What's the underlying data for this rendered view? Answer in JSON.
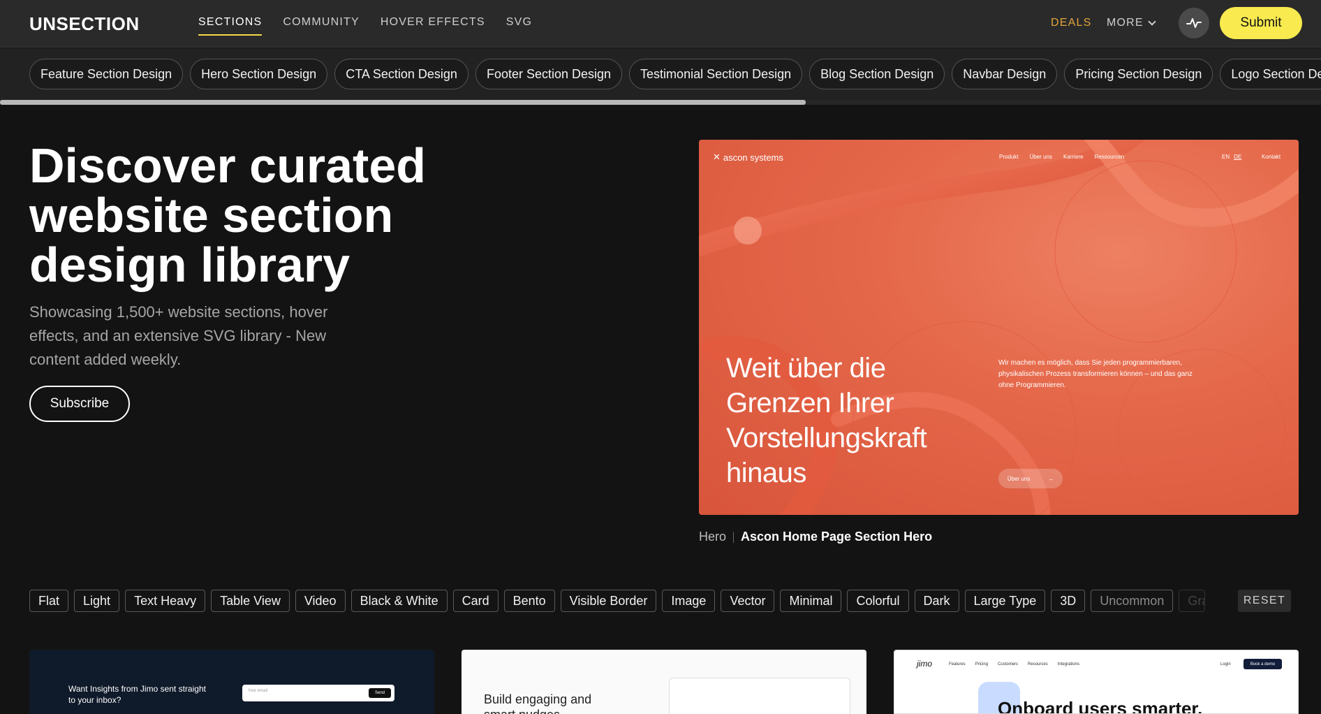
{
  "nav": {
    "logo": "UNSECTION",
    "links": [
      "SECTIONS",
      "COMMUNITY",
      "HOVER EFFECTS",
      "SVG"
    ],
    "deals": "DEALS",
    "more": "MORE",
    "submit": "Submit",
    "accent": "#f8ea4f",
    "deals_color": "#e2a53a"
  },
  "categories": [
    "Feature Section Design",
    "Hero Section Design",
    "CTA Section Design",
    "Footer Section Design",
    "Testimonial Section Design",
    "Blog Section Design",
    "Navbar Design",
    "Pricing Section Design",
    "Logo Section Design"
  ],
  "hero": {
    "title": "Discover curated website section design library",
    "subtitle": "Showcasing 1,500+ website sections, hover effects, and an extensive SVG library - New content added weekly.",
    "subscribe": "Subscribe"
  },
  "preview": {
    "logo": "ascon systems",
    "nav": [
      "Produkt",
      "Über uns",
      "Karriere",
      "Ressourcen"
    ],
    "lang": [
      "EN",
      "DE"
    ],
    "contact": "Kontakt",
    "headline": "Weit über die Grenzen Ihrer Vorstellungskraft hinaus",
    "body": "Wir machen es möglich, dass Sie jeden programmierbaren, physikalischen Prozess transformieren können – und das ganz ohne Programmieren.",
    "button": "Über uns",
    "bg_color": "#e5684a"
  },
  "caption": {
    "category": "Hero",
    "title": "Ascon Home Page Section Hero"
  },
  "tags": [
    "Flat",
    "Light",
    "Text Heavy",
    "Table View",
    "Video",
    "Black & White",
    "Card",
    "Bento",
    "Visible Border",
    "Image",
    "Vector",
    "Minimal",
    "Colorful",
    "Dark",
    "Large Type",
    "3D",
    "Uncommon",
    "Gra"
  ],
  "reset": "RESET",
  "cards": {
    "card1": {
      "title": "Want Insights from Jimo sent straight to your inbox?",
      "placeholder": "Your email",
      "send": "Send"
    },
    "card2": {
      "title": "Build engaging and smart nudges"
    },
    "card3": {
      "logo": "jimo",
      "nav": [
        "Features",
        "Pricing",
        "Customers",
        "Resources",
        "Integrations"
      ],
      "login": "Login",
      "demo": "Book a demo",
      "title": "Onboard users smarter."
    }
  }
}
